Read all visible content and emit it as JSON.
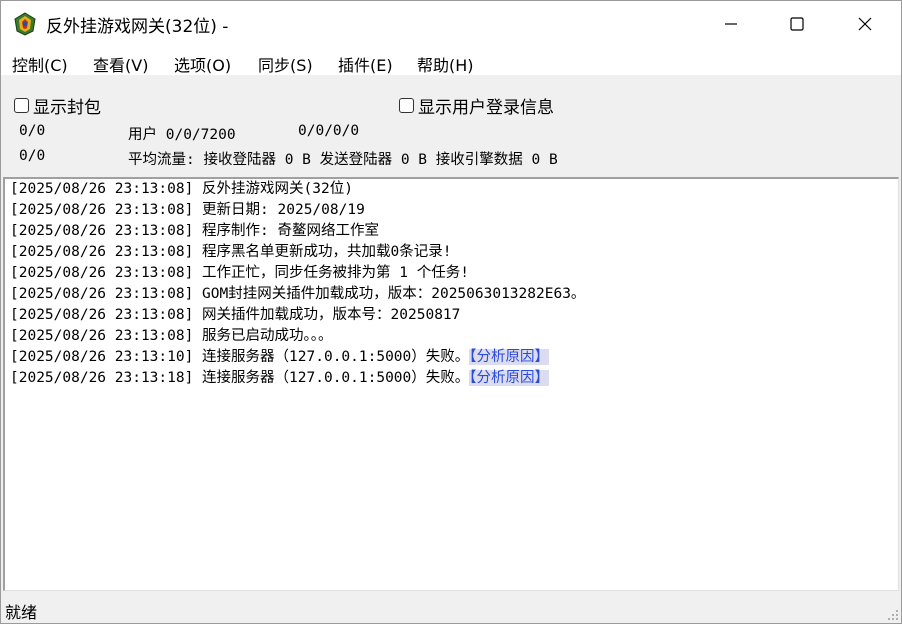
{
  "window": {
    "title": "反外挂游戏网关(32位) -"
  },
  "menu": {
    "items": [
      {
        "label": "控制(C)"
      },
      {
        "label": "查看(V)"
      },
      {
        "label": "选项(O)"
      },
      {
        "label": "同步(S)"
      },
      {
        "label": "插件(E)"
      },
      {
        "label": "帮助(H)"
      }
    ]
  },
  "options": {
    "show_packets_label": "显示封包",
    "show_login_info_label": "显示用户登录信息"
  },
  "stats": {
    "row1_left": "0/0",
    "row1_users": "用户 0/0/7200",
    "row1_counts": "0/0/0/0",
    "row2_left": "0/0",
    "row2_traffic": "平均流量: 接收登陆器 0 B 发送登陆器 0 B 接收引擎数据 0 B"
  },
  "log": {
    "lines": [
      {
        "text": "[2025/08/26 23:13:08] 反外挂游戏网关(32位)",
        "link": ""
      },
      {
        "text": "[2025/08/26 23:13:08] 更新日期: 2025/08/19",
        "link": ""
      },
      {
        "text": "[2025/08/26 23:13:08] 程序制作: 奇鳌网络工作室",
        "link": ""
      },
      {
        "text": "[2025/08/26 23:13:08] 程序黑名单更新成功，共加载0条记录!",
        "link": ""
      },
      {
        "text": "[2025/08/26 23:13:08] 工作正忙，同步任务被排为第 1 个任务!",
        "link": ""
      },
      {
        "text": "[2025/08/26 23:13:08] GOM封挂网关插件加载成功，版本：2025063013282E63。",
        "link": ""
      },
      {
        "text": "[2025/08/26 23:13:08] 网关插件加载成功，版本号：20250817",
        "link": ""
      },
      {
        "text": "[2025/08/26 23:13:08] 服务已启动成功。。。",
        "link": ""
      },
      {
        "text": "[2025/08/26 23:13:10] 连接服务器（127.0.0.1:5000）失败。",
        "link": "【分析原因】"
      },
      {
        "text": "[2025/08/26 23:13:18] 连接服务器（127.0.0.1:5000）失败。",
        "link": "【分析原因】"
      }
    ]
  },
  "status": {
    "text": "就绪"
  },
  "icons": {
    "app": "app-icon",
    "minimize": "minimize-icon",
    "maximize": "maximize-icon",
    "close": "close-icon",
    "grip": "resize-grip-icon"
  },
  "colors": {
    "link_text": "#2a4bd7",
    "link_bg": "#dcdcf0",
    "panel_bg": "#f0f0f0"
  }
}
